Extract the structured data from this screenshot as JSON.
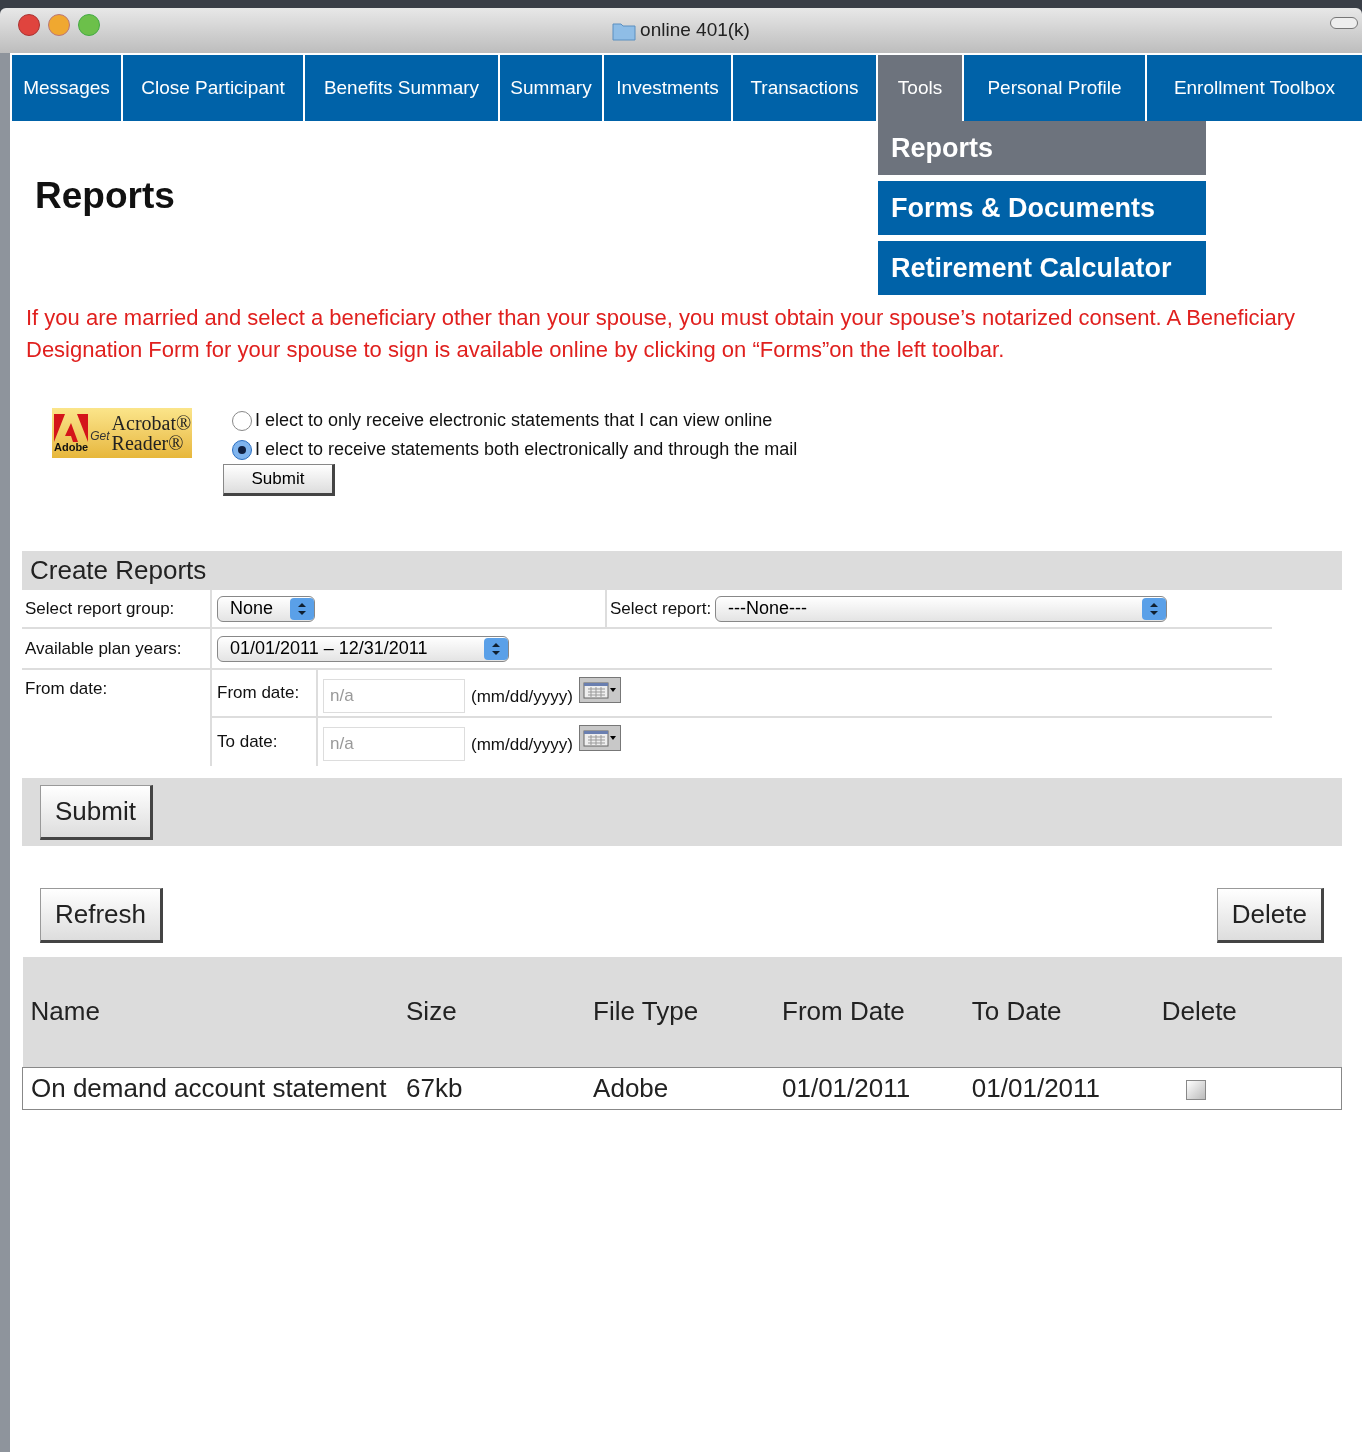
{
  "window": {
    "title": "online 401(k)"
  },
  "nav": [
    {
      "label": "Messages",
      "selected": false
    },
    {
      "label": "Close Participant",
      "selected": false
    },
    {
      "label": "Benefits Summary",
      "selected": false
    },
    {
      "label": "Summary",
      "selected": false
    },
    {
      "label": "Investments",
      "selected": false
    },
    {
      "label": "Transactions",
      "selected": false
    },
    {
      "label": "Tools",
      "selected": true
    },
    {
      "label": "Personal Profile",
      "selected": false
    },
    {
      "label": "Enrollment Toolbox",
      "selected": false
    }
  ],
  "tools_menu": [
    {
      "label": "Reports",
      "selected": true
    },
    {
      "label": "Forms & Documents",
      "selected": false
    },
    {
      "label": "Retirement Calculator",
      "selected": false
    }
  ],
  "heading": "Reports",
  "notice": "If you are married and select a beneficiary other than your spouse, you must obtain your spouse’s notarized consent.  A Beneficiary Designation Form for your spouse to sign is available online by clicking on “Forms”on the left toolbar.",
  "acrobat_badge": {
    "brand": "Adobe",
    "get": "Get",
    "line1": "Acrobat®",
    "line2": "Reader®"
  },
  "statement_options": [
    {
      "label": "I elect to only receive electronic statements that I can view online",
      "selected": false
    },
    {
      "label": "I elect to receive statements both electronically and through the mail",
      "selected": true
    }
  ],
  "statement_submit": "Submit",
  "create_reports": {
    "title": "Create Reports",
    "report_group": {
      "label": "Select report group:",
      "value": "None"
    },
    "select_report": {
      "label": "Select report:",
      "value": "---None---"
    },
    "plan_years": {
      "label": "Available plan years:",
      "value": "01/01/2011 – 12/31/2011"
    },
    "date_section_label": "From date:",
    "dates": [
      {
        "label": "From date:",
        "placeholder": "n/a",
        "hint": "(mm/dd/yyyy)"
      },
      {
        "label": "To date:",
        "placeholder": "n/a",
        "hint": "(mm/dd/yyyy)"
      }
    ],
    "submit": "Submit"
  },
  "refresh": "Refresh",
  "delete": "Delete",
  "table": {
    "columns": [
      "Name",
      "Size",
      "File Type",
      "From Date",
      "To Date",
      "Delete"
    ],
    "rows": [
      {
        "cells": [
          "On demand account statement",
          "67kb",
          "Adobe",
          "01/01/2011",
          "01/01/2011"
        ],
        "checked": false
      }
    ]
  }
}
